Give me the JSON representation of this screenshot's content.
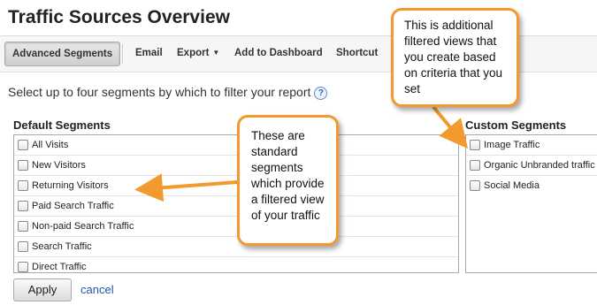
{
  "page": {
    "title": "Traffic Sources Overview"
  },
  "toolbar": {
    "advanced_segments": "Advanced Segments",
    "email": "Email",
    "export": "Export",
    "add_to_dashboard": "Add to Dashboard",
    "shortcut": "Shortcut"
  },
  "instruction": "Select up to four segments by which to filter your report",
  "default_segments": {
    "title": "Default Segments",
    "items": [
      "All Visits",
      "New Visitors",
      "Returning Visitors",
      "Paid Search Traffic",
      "Non-paid Search Traffic",
      "Search Traffic",
      "Direct Traffic"
    ]
  },
  "custom_segments": {
    "title": "Custom Segments",
    "items": [
      "Image Traffic",
      "Organic Unbranded traffic",
      "Social Media"
    ]
  },
  "actions": {
    "apply": "Apply",
    "cancel": "cancel"
  },
  "callouts": {
    "default": "These are standard segments which provide a filtered view of your traffic",
    "custom": "This is additional filtered views that you create based on criteria that you set"
  },
  "colors": {
    "callout_border": "#f29a2e",
    "link": "#2255aa"
  },
  "icons": {
    "help": "help-icon",
    "dropdown": "caret-down-icon",
    "checkbox": "checkbox"
  }
}
